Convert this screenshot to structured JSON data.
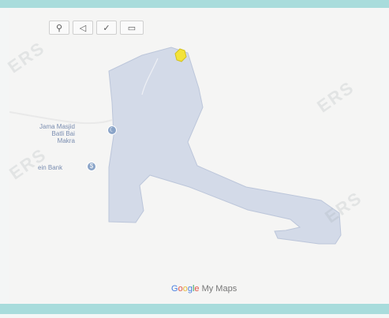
{
  "toolbar": {
    "buttons": [
      {
        "name": "marker-tool-button",
        "icon": "location-pin-icon",
        "glyph": "⚲"
      },
      {
        "name": "line-tool-button",
        "icon": "polygon-draw-icon",
        "glyph": "◁"
      },
      {
        "name": "measure-tool-button",
        "icon": "check-measure-icon",
        "glyph": "✓"
      },
      {
        "name": "ruler-tool-button",
        "icon": "ruler-icon",
        "glyph": "▭"
      }
    ]
  },
  "map": {
    "area_fill": "#d3dae8",
    "area_stroke": "#bcc6da",
    "marker_color": "#f3e33a",
    "poi_color": "#8aa4c8",
    "pois": [
      {
        "label_line1": "Jama Masjid",
        "label_line2": "Batli Bai",
        "label_line3": "Makra"
      },
      {
        "label_line1": "ein Bank",
        "label_line2": "",
        "label_line3": ""
      }
    ]
  },
  "logo": {
    "letters": [
      "G",
      "o",
      "o",
      "g",
      "l",
      "e"
    ],
    "suffix": "My Maps"
  },
  "watermark": {
    "text": "ERS"
  }
}
